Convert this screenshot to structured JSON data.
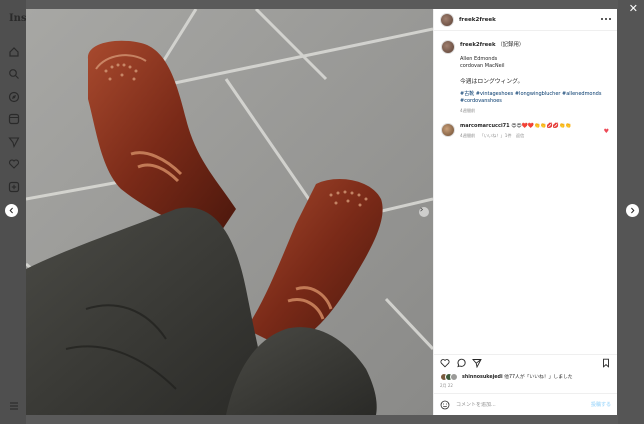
{
  "app": {
    "logo_text": "Inst"
  },
  "post": {
    "username": "freek2freek",
    "caption": {
      "username": "freek2freek",
      "tag": "（記録用）",
      "lines": [
        "Allen Edmonds",
        "cordovan MacNeil"
      ],
      "jp_text": "今週はロングウィング。",
      "hashtags": [
        "#古靴 #vintageshoes #longwingblucher #allenedmonds",
        "#cordovanshoes"
      ],
      "time": "4週間前"
    },
    "comment": {
      "username": "marcomarcucci71",
      "emojis": "😍😍❤️❤️👏👏💋💋👏👏",
      "time": "4週間前",
      "likes": "「いいね！」1件",
      "reply": "返信"
    },
    "likes": {
      "username": "shinnosukejedi",
      "text": "他77人が「いいね！」しました"
    },
    "date": "2月 22",
    "add_comment": {
      "placeholder": "コメントを追加...",
      "post_label": "投稿する"
    }
  },
  "colors": {
    "link": "#00376b",
    "heart": "#ed4956",
    "post_button": "#b2dffc"
  }
}
